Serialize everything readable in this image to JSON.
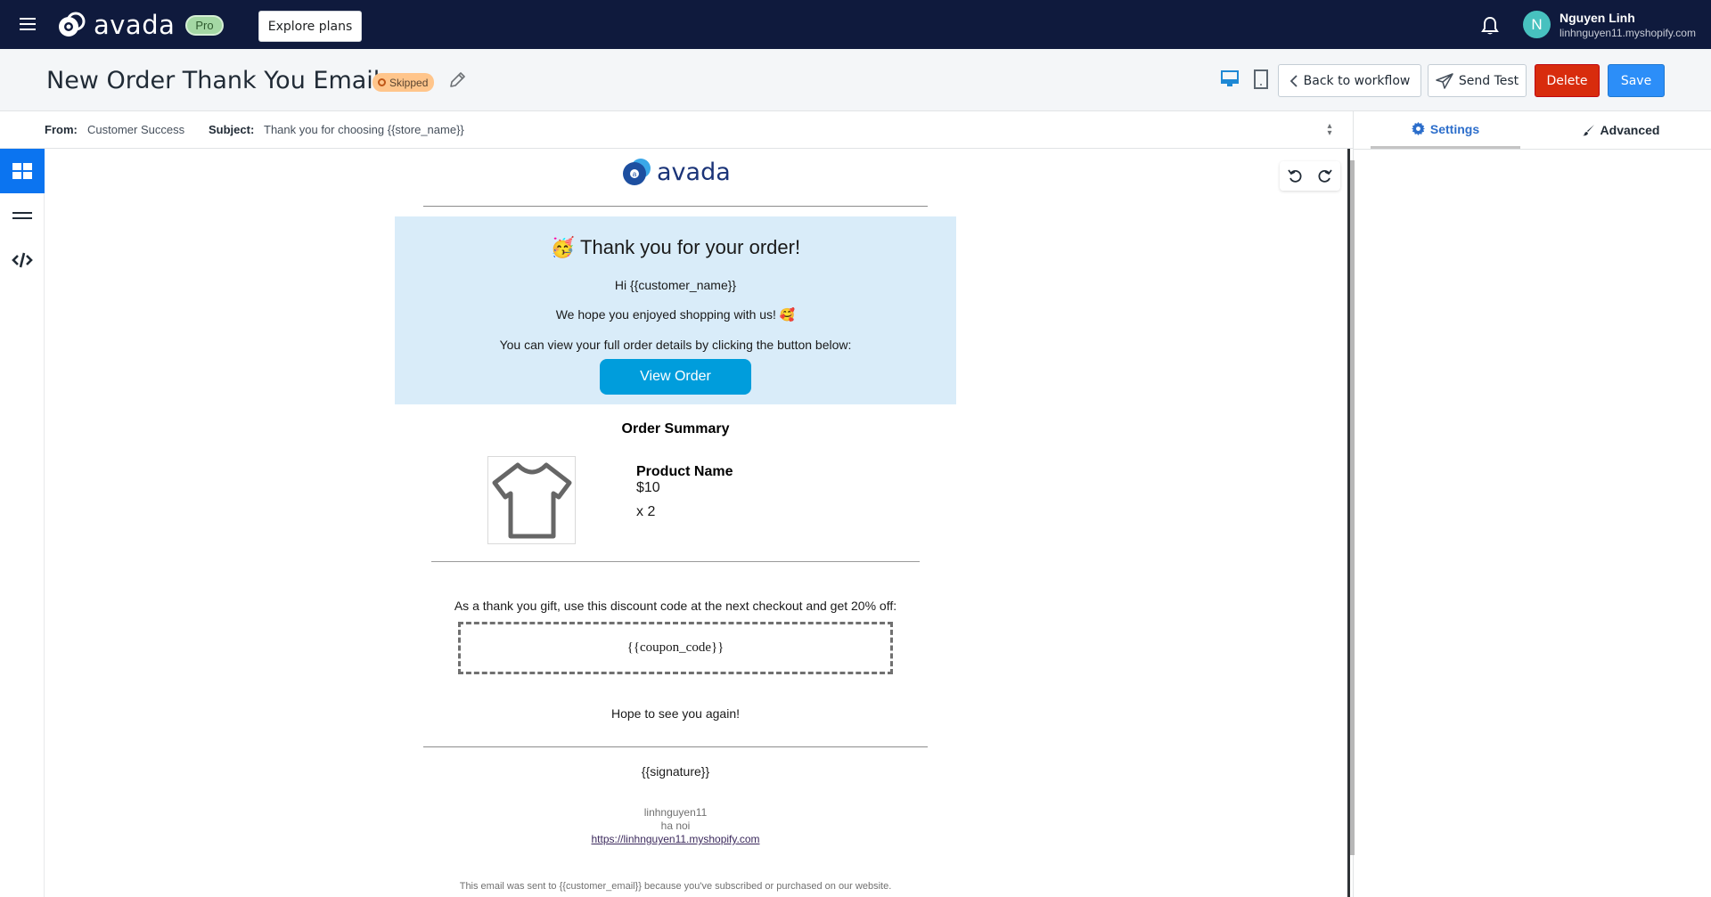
{
  "topbar": {
    "brand": "avada",
    "plan_badge": "Pro",
    "explore_label": "Explore plans",
    "user": {
      "initial": "N",
      "name": "Nguyen Linh",
      "shop": "linhnguyen11.myshopify.com"
    }
  },
  "header": {
    "title": "New Order Thank You Email",
    "status": "Skipped",
    "buttons": {
      "back": "Back to workflow",
      "send_test": "Send Test",
      "delete": "Delete",
      "save": "Save"
    }
  },
  "subject_bar": {
    "from_label": "From:",
    "from_value": "Customer Success",
    "subject_label": "Subject:",
    "subject_value": "Thank you for choosing {{store_name}}"
  },
  "right_panel": {
    "tabs": [
      {
        "label": "Settings",
        "active": true
      },
      {
        "label": "Advanced",
        "active": false
      }
    ]
  },
  "left_sidebar": {
    "items": [
      {
        "icon": "blocks-grid-icon",
        "active": true
      },
      {
        "icon": "rows-icon",
        "active": false
      },
      {
        "icon": "code-icon",
        "active": false
      }
    ]
  },
  "email": {
    "logo_text": "avada",
    "hero": {
      "title": "Thank you for your order!",
      "title_emoji": "🥳",
      "greeting": "Hi {{customer_name}}",
      "line1": "We hope you enjoyed shopping with us!",
      "line1_emoji": "🥰",
      "line2": "You can view your full order details by clicking the button below:",
      "button": "View Order"
    },
    "order_summary": {
      "heading": "Order Summary",
      "product_name": "Product Name",
      "price": "$10",
      "quantity": "x 2"
    },
    "discount_text": "As a thank you gift, use this discount code at the next checkout and get 20% off:",
    "coupon_code": "{{coupon_code}}",
    "closing": "Hope to see you again!",
    "signature": "{{signature}}",
    "store_name": "linhnguyen11",
    "store_address": "ha noi",
    "store_url": "https://linhnguyen11.myshopify.com",
    "footer_note": "This email was sent to {{customer_email}} because you've subscribed or purchased on our website."
  },
  "colors": {
    "topbar_bg": "#0f1a3d",
    "accent_blue": "#2c8ef8",
    "delete_red": "#d82c0d",
    "hero_bg": "#d9ecf9",
    "view_order_btn": "#009ddc",
    "skipped_badge": "#ffc58b"
  }
}
